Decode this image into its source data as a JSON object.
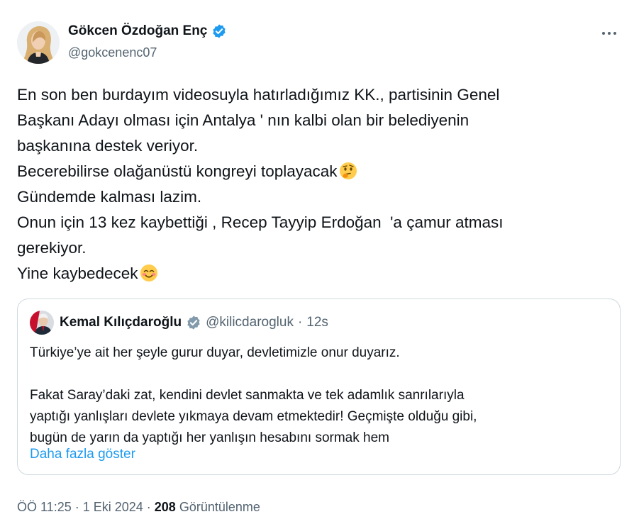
{
  "author": {
    "name": "Gökcen Özdoğan Enç",
    "handle": "@gokcenenc07",
    "verified_color": "#1d9bf0"
  },
  "menu": {
    "icon": "more-icon"
  },
  "tweet": {
    "lines": [
      "En son ben burdayım videosuyla hatırladığımız KK., partisinin Genel",
      "Başkanı Adayı olması için Antalya ' nın kalbi olan bir belediyenin",
      "başkanına destek veriyor.",
      "Becerebilirse olağanüstü kongreyi toplayacak",
      "Gündemde kalması lazim.",
      "Onun için 13 kez kaybettiği , Recep Tayyip Erdoğan  'a çamur atması",
      "gerekiyor.",
      "Yine kaybedecek"
    ],
    "emoji_thinking": "thinking-face-emoji",
    "emoji_smiling": "smiling-face-emoji"
  },
  "quote": {
    "name": "Kemal Kılıçdaroğlu",
    "handle": "@kilicdarogluk",
    "separator": "·",
    "time": "12s",
    "lines": [
      "Türkiye’ye ait her şeyle gurur duyar, devletimizle onur duyarız.",
      "",
      "Fakat Saray’daki zat, kendini devlet sanmakta ve tek adamlık sanrılarıyla",
      "yaptığı yanlışları devlete yıkmaya devam etmektedir! Geçmişte olduğu gibi,",
      "bugün de yarın da yaptığı her yanlışın hesabını sormak hem"
    ],
    "show_more": "Daha fazla göster"
  },
  "meta": {
    "time": "ÖÖ 11:25",
    "separator": "·",
    "date": "1 Eki 2024",
    "views_count": "208",
    "views_label": "Görüntülenme"
  },
  "colors": {
    "text": "#0f1419",
    "secondary": "#536471",
    "link": "#1d9bf0",
    "border": "#cfd9de"
  }
}
